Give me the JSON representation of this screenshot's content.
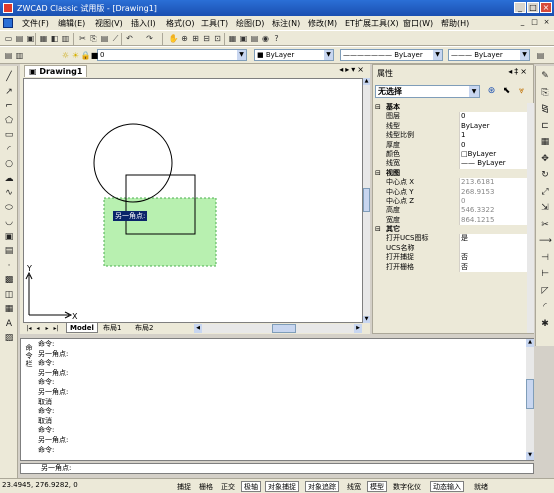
{
  "titlebar": {
    "title": "ZWCAD Classic 试用版 - [Drawing1]",
    "minimize": "_",
    "maximize": "□",
    "close": "×"
  },
  "menubar": {
    "items": [
      "文件(F)",
      "编辑(E)",
      "视图(V)",
      "插入(I)",
      "格式(O)",
      "工具(T)",
      "绘图(D)",
      "标注(N)",
      "修改(M)",
      "ET扩展工具(X)",
      "窗口(W)",
      "帮助(H)"
    ],
    "mdi_controls": [
      "_",
      "□",
      "×"
    ]
  },
  "toolbar1": {
    "icons": [
      "new-icon",
      "open-icon",
      "save-icon",
      "print-icon",
      "preview-icon",
      "plot-icon",
      "cut-icon",
      "copy-icon",
      "paste-icon",
      "match-icon",
      "undo-icon",
      "redo-icon",
      "pan-icon",
      "zoom-realtime-icon",
      "zoom-window-icon",
      "zoom-previous-icon",
      "zoom-extents-icon",
      "properties-icon",
      "designcenter-icon",
      "toolpalette-icon",
      "calc-icon",
      "help-icon"
    ],
    "glyphs": [
      "▭",
      "▤",
      "▣",
      "▦",
      "◧",
      "▥",
      "✂",
      "⎘",
      "▤",
      "⟋",
      "↶",
      "↷",
      "✋",
      "⊕",
      "⊞",
      "⊟",
      "⊡",
      "▦",
      "▣",
      "▤",
      "◉",
      "?"
    ]
  },
  "toolbar2": {
    "layer_value": "0",
    "color_value": "ByLayer",
    "linetype_value": "ByLayer",
    "lineweight_value": "ByLayer",
    "icons": [
      "layer-manager-icon",
      "layer-state-icon",
      "lightbulb-icon",
      "sun-icon",
      "lock-icon",
      "color-swatch-icon"
    ],
    "glyphs": [
      "▤",
      "▥",
      "☼",
      "☀",
      "🔒",
      "■"
    ]
  },
  "drawing": {
    "tab_title": "Drawing1",
    "window_controls": [
      "◂",
      "▸",
      "▾",
      "×"
    ],
    "prompt_label": "另一角点:",
    "axis_x": "X",
    "axis_y": "Y",
    "layout_tabs": [
      "Model",
      "布局1",
      "布局2"
    ],
    "nav_buttons": [
      "|◂",
      "◂",
      "▸",
      "▸|"
    ],
    "selection_color": "#b8f0b0",
    "selection_border": "#4caf50",
    "prompt_bg": "#0a246a"
  },
  "properties": {
    "header": "属性",
    "header_controls": [
      "◂",
      "‡",
      "×"
    ],
    "selection": "无选择",
    "rows": [
      {
        "name": "基本",
        "value": "",
        "category": true,
        "toggle": "⊟"
      },
      {
        "name": "图层",
        "value": "0"
      },
      {
        "name": "线型",
        "value": "ByLayer"
      },
      {
        "name": "线型比例",
        "value": "1"
      },
      {
        "name": "厚度",
        "value": "0"
      },
      {
        "name": "颜色",
        "value": "□ByLayer"
      },
      {
        "name": "线宽",
        "value": "—— ByLayer"
      },
      {
        "name": "视图",
        "value": "",
        "category": true,
        "toggle": "⊟"
      },
      {
        "name": "中心点 X",
        "value": "213.6181",
        "gray": true
      },
      {
        "name": "中心点 Y",
        "value": "268.9153",
        "gray": true
      },
      {
        "name": "中心点 Z",
        "value": "0",
        "gray": true
      },
      {
        "name": "高度",
        "value": "546.3322",
        "gray": true
      },
      {
        "name": "宽度",
        "value": "864.1215",
        "gray": true
      },
      {
        "name": "其它",
        "value": "",
        "category": true,
        "toggle": "⊟"
      },
      {
        "name": "打开UCS图标",
        "value": "是"
      },
      {
        "name": "UCS名称",
        "value": ""
      },
      {
        "name": "打开捕捉",
        "value": "否"
      },
      {
        "name": "打开栅格",
        "value": "否"
      }
    ]
  },
  "command": {
    "label": "命令栏",
    "lines": [
      "命令:",
      "另一角点:",
      "命令:",
      "另一角点:",
      "命令:",
      "另一角点:",
      "取消",
      "命令:",
      "取消",
      "命令:",
      "另一角点:",
      "命令:"
    ],
    "current_prompt": "另一角点:"
  },
  "statusbar": {
    "coords": "23.4945,  276.9282,  0",
    "buttons": [
      {
        "label": "捕捉",
        "on": false
      },
      {
        "label": "栅格",
        "on": false
      },
      {
        "label": "正交",
        "on": false
      },
      {
        "label": "极轴",
        "on": true
      },
      {
        "label": "对象捕捉",
        "on": true
      },
      {
        "label": "对象追踪",
        "on": true
      },
      {
        "label": "线宽",
        "on": false
      },
      {
        "label": "模型",
        "on": true
      },
      {
        "label": "数字化仪",
        "on": false
      },
      {
        "label": "动态输入",
        "on": true
      },
      {
        "label": "就绪",
        "on": false
      }
    ]
  },
  "left_tools": {
    "icons": [
      "line-icon",
      "ray-icon",
      "polyline-icon",
      "polygon-icon",
      "rectangle-icon",
      "arc-icon",
      "circle-icon",
      "revcloud-icon",
      "spline-icon",
      "ellipse-icon",
      "ellipse-arc-icon",
      "insert-block-icon",
      "make-block-icon",
      "point-icon",
      "hatch-icon",
      "region-icon",
      "table-icon",
      "mtext-icon",
      "image-icon"
    ],
    "glyphs": [
      "╱",
      "↗",
      "⌐",
      "⬠",
      "▭",
      "◜",
      "○",
      "☁",
      "∿",
      "⬭",
      "◡",
      "▣",
      "▤",
      "·",
      "▩",
      "◫",
      "▦",
      "A",
      "▨"
    ]
  },
  "right_tools": {
    "icons": [
      "erase-icon",
      "copy-object-icon",
      "mirror-icon",
      "offset-icon",
      "array-icon",
      "move-icon",
      "rotate-icon",
      "scale-icon",
      "stretch-icon",
      "trim-icon",
      "extend-icon",
      "break-icon",
      "join-icon",
      "chamfer-icon",
      "fillet-icon",
      "explode-icon"
    ],
    "glyphs": [
      "✎",
      "⎘",
      "⧎",
      "⊏",
      "▦",
      "✥",
      "↻",
      "⤢",
      "⇲",
      "✂",
      "⟶",
      "⊣",
      "⊢",
      "◸",
      "◜",
      "✱"
    ]
  }
}
